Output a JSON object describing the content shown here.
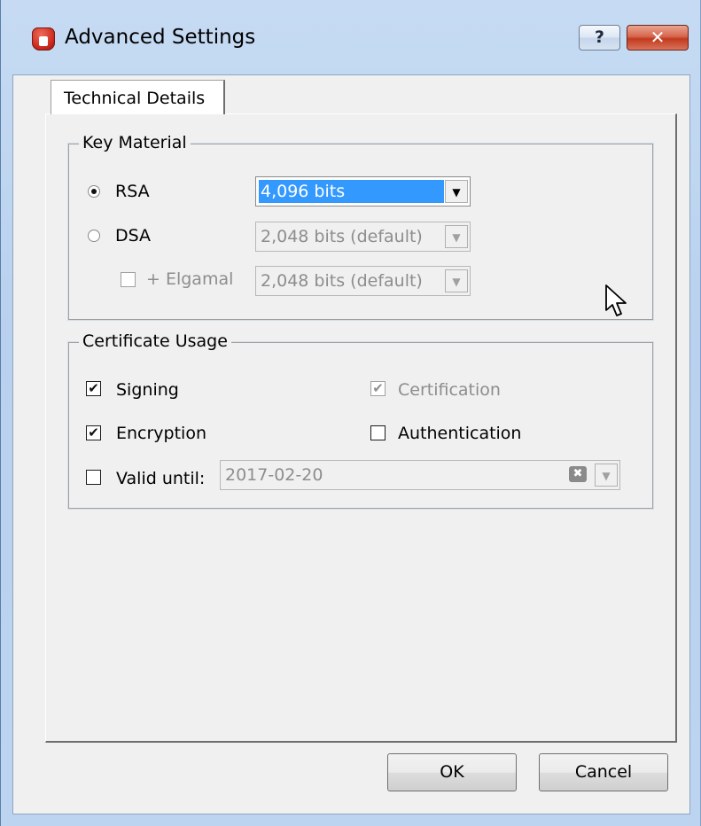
{
  "window": {
    "title": "Advanced Settings",
    "help_glyph": "?",
    "close_glyph": "✕"
  },
  "tabs": [
    {
      "label": "Technical Details",
      "active": true
    }
  ],
  "key_material": {
    "title": "Key Material",
    "rsa": {
      "label": "RSA",
      "selected": true,
      "value": "4,096 bits"
    },
    "dsa": {
      "label": "DSA",
      "selected": false,
      "value": "2,048 bits (default)"
    },
    "elgamal": {
      "label": "+ Elgamal",
      "checked": false,
      "value": "2,048 bits (default)"
    }
  },
  "certificate_usage": {
    "title": "Certificate Usage",
    "signing": {
      "label": "Signing",
      "checked": true
    },
    "certification": {
      "label": "Certification",
      "checked": true,
      "disabled": true
    },
    "encryption": {
      "label": "Encryption",
      "checked": true
    },
    "authentication": {
      "label": "Authentication",
      "checked": false
    },
    "valid_until": {
      "label": "Valid until:",
      "checked": false,
      "value": "2017-02-20"
    }
  },
  "buttons": {
    "ok": "OK",
    "cancel": "Cancel"
  },
  "glyphs": {
    "check": "✔",
    "dropdown": "▼",
    "clear": "✖"
  }
}
